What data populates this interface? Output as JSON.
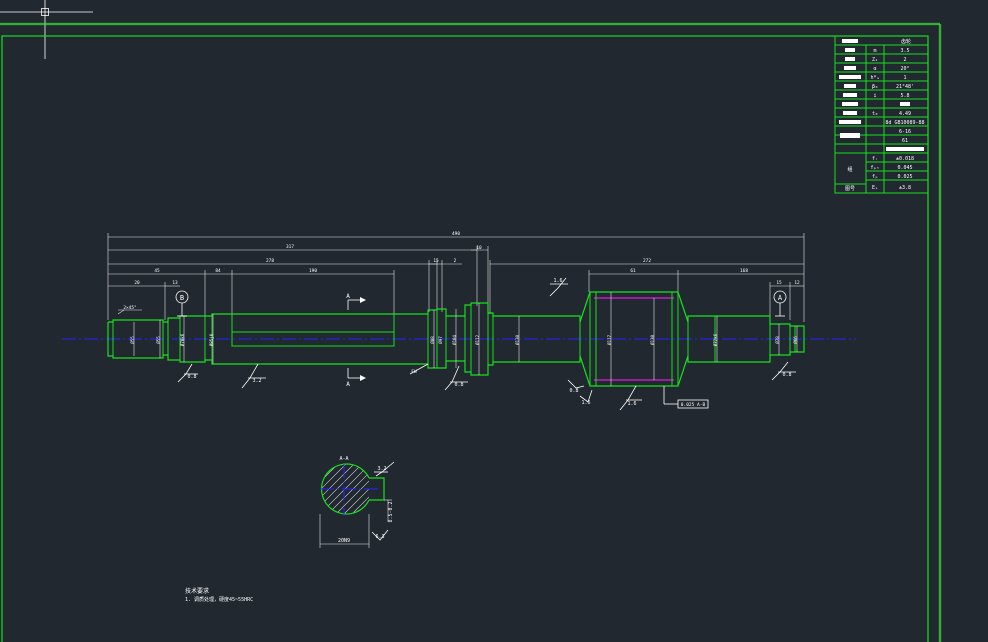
{
  "title_block": {
    "header": "齿轮",
    "rows": [
      {
        "symbol": "m",
        "value": "3.5"
      },
      {
        "symbol": "Z₁",
        "value": "2"
      },
      {
        "symbol": "α",
        "value": "20°"
      },
      {
        "symbol": "h*ₐ",
        "value": "1"
      },
      {
        "symbol": "β₀",
        "value": "21°48'"
      },
      {
        "symbol": "i",
        "value": "5.8"
      },
      {
        "symbol": "",
        "value": ""
      },
      {
        "symbol": "t₀",
        "value": "4.49"
      },
      {
        "symbol": "",
        "value": "8d GB10089-88"
      },
      {
        "symbol": "",
        "value": "6-16"
      },
      {
        "symbol": "",
        "value": "61"
      },
      {
        "symbol": "",
        "value": ""
      }
    ],
    "check_label": "组",
    "check_rows": [
      {
        "symbol": "fᵣ",
        "value": "±0.018"
      },
      {
        "symbol": "fₚₜ",
        "value": "0.045"
      },
      {
        "symbol": "fₚ",
        "value": "0.025"
      }
    ],
    "last_row": {
      "label": "图号",
      "symbol": "Eₛ",
      "value": "±3.8"
    }
  },
  "dimensions": {
    "overall": "490",
    "d317": "317",
    "d278": "278",
    "d190": "190",
    "d45": "45",
    "d84": "84",
    "d20": "20",
    "d13": "13",
    "d15": "15",
    "d10": "10",
    "d2": "2",
    "d17": "17",
    "d272": "272",
    "d61": "61",
    "d168": "168",
    "d53": "53",
    "d30": "30",
    "d15r": "15",
    "d12": "12",
    "chamfer": "2×45°"
  },
  "vertical_dims": [
    "Ø55",
    "Ø55",
    "Ø70k6",
    "Ø85j6",
    "Ø88",
    "Ø97",
    "Ø104",
    "Ø112",
    "Ø130",
    "Ø117",
    "Ø130",
    "Ø72k6",
    "Ø78",
    "Ø66"
  ],
  "datums": {
    "left": "B",
    "right": "A"
  },
  "roughness": [
    "0.8",
    "3.2",
    "0.8",
    "0.8",
    "1.6",
    "1.6",
    "0.8",
    "1.6"
  ],
  "section": {
    "arrow_label": "A",
    "title": "A-A",
    "roughness_top": "3.2",
    "roughness_bottom": "6.3",
    "width_dim": "20N9",
    "depth_dim": "8.5-0.2"
  },
  "misc": {
    "fw": "FW",
    "tol_frame": "0.025 A-B"
  },
  "notes": {
    "title": "技术要求",
    "line1": "1. 调质处理，硬度45~55HRC"
  }
}
